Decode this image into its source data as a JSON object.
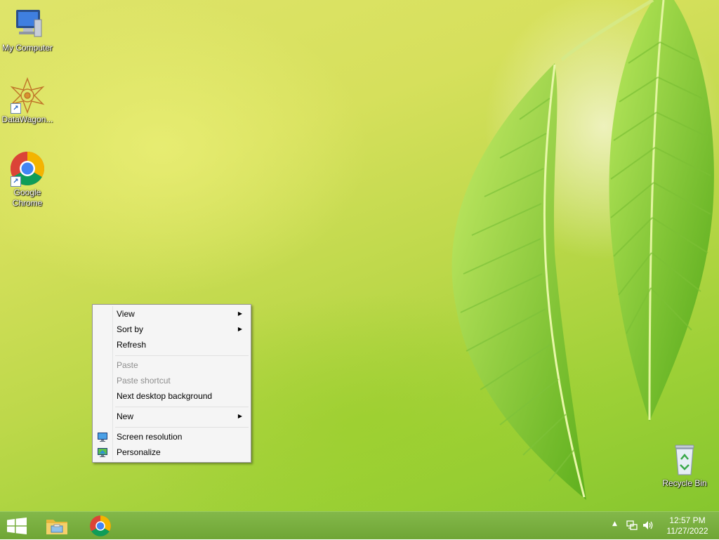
{
  "desktop": {
    "icons": {
      "my_computer": "My Computer",
      "datawagon": "DataWagon...",
      "chrome_line1": "Google",
      "chrome_line2": "Chrome",
      "recycle_bin": "Recycle Bin"
    }
  },
  "context_menu": {
    "items": [
      {
        "label": "View",
        "submenu": true,
        "enabled": true
      },
      {
        "label": "Sort by",
        "submenu": true,
        "enabled": true
      },
      {
        "label": "Refresh",
        "enabled": true
      },
      {
        "label": "Paste",
        "enabled": false
      },
      {
        "label": "Paste shortcut",
        "enabled": false
      },
      {
        "label": "Next desktop background",
        "enabled": true
      },
      {
        "label": "New",
        "submenu": true,
        "enabled": true
      },
      {
        "label": "Screen resolution",
        "icon": "monitor-icon",
        "enabled": true
      },
      {
        "label": "Personalize",
        "icon": "personalize-monitor-icon",
        "enabled": true
      }
    ]
  },
  "taskbar": {
    "items": [
      {
        "name": "start-button",
        "icon": "windows-logo-icon"
      },
      {
        "name": "file-explorer",
        "icon": "folder-icon"
      },
      {
        "name": "google-chrome",
        "icon": "chrome-icon"
      }
    ],
    "tray": {
      "icons": [
        "show-hidden-icons-arrow",
        "network-icon",
        "volume-icon"
      ],
      "time": "12:57 PM",
      "date": "11/27/2022"
    }
  },
  "colors": {
    "taskbar": "#76ab3c",
    "menu_background": "#f5f5f5",
    "disabled_text": "#8d8d8d"
  }
}
